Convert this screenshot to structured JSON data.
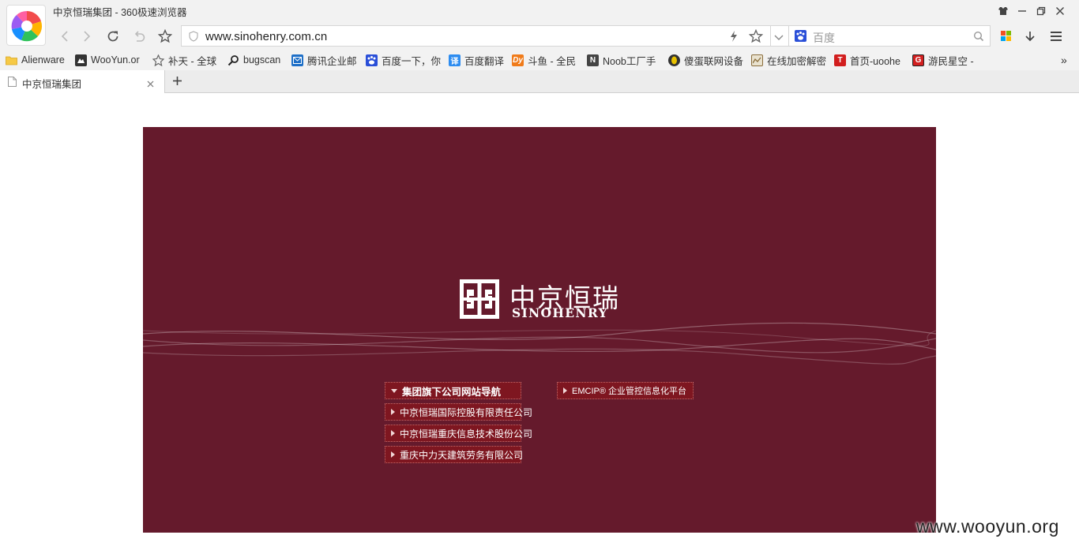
{
  "window": {
    "title": "中京恒瑞集团 - 360极速浏览器"
  },
  "toolbar": {
    "url": "www.sinohenry.com.cn",
    "search_placeholder": "百度"
  },
  "bookmarks": [
    {
      "label": "Alienware",
      "icon": "folder-icon",
      "color": "#f6c945"
    },
    {
      "label": "WooYun.or",
      "icon": "wooyun-icon",
      "color": "#333333"
    },
    {
      "label": "补天 - 全球",
      "icon": "butian-icon",
      "color": "#888888"
    },
    {
      "label": "bugscan",
      "icon": "magnifier-icon",
      "color": "#333333"
    },
    {
      "label": "腾讯企业邮",
      "icon": "tencent-mail-icon",
      "color": "#1e6fc7"
    },
    {
      "label": "百度一下，你",
      "icon": "baidu-icon",
      "color": "#2a4fd8"
    },
    {
      "label": "百度翻译",
      "icon": "translate-icon",
      "color": "#2d8cf0"
    },
    {
      "label": "斗鱼 - 全民",
      "icon": "douyu-icon",
      "color": "#f07b1a"
    },
    {
      "label": "Noob工厂手",
      "icon": "noob-icon",
      "color": "#444444"
    },
    {
      "label": "傻蛋联网设备",
      "icon": "shodan-icon",
      "color": "#c8a400"
    },
    {
      "label": "在线加密解密",
      "icon": "crypto-icon",
      "color": "#8a6d3b"
    },
    {
      "label": "首页-uoohe",
      "icon": "uoohe-icon",
      "color": "#d21f1f"
    },
    {
      "label": "游民星空 -",
      "icon": "gamersky-icon",
      "color": "#d21f1f"
    }
  ],
  "tabs": [
    {
      "title": "中京恒瑞集团"
    }
  ],
  "page": {
    "logo_cn": "中京恒瑞",
    "logo_en": "SINOHENRY",
    "nav_left": [
      {
        "label": "集团旗下公司网站导航",
        "expanded": true
      },
      {
        "label": "中京恒瑞国际控股有限责任公司",
        "expanded": false
      },
      {
        "label": "中京恒瑞重庆信息技术股份公司",
        "expanded": false
      },
      {
        "label": "重庆中力天建筑劳务有限公司",
        "expanded": false
      }
    ],
    "nav_right": [
      {
        "label": "EMCIP® 企业管控信息化平台"
      }
    ],
    "banner_color": "#651a2c"
  },
  "watermark": "www.wooyun.org"
}
